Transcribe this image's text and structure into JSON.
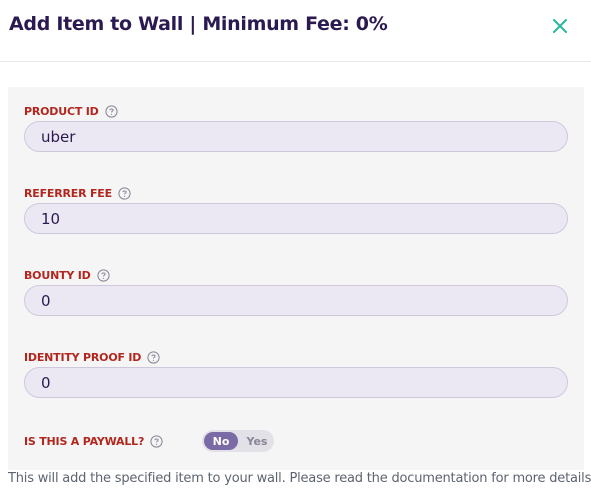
{
  "header": {
    "title": "Add Item to Wall | Minimum Fee: 0%",
    "close_icon": "close-icon"
  },
  "form": {
    "product_id": {
      "label": "PRODUCT ID",
      "value": "uber"
    },
    "referrer_fee": {
      "label": "REFERRER FEE",
      "value": "10"
    },
    "bounty_id": {
      "label": "BOUNTY ID",
      "value": "0"
    },
    "identity_proof_id": {
      "label": "IDENTITY PROOF ID",
      "value": "0"
    },
    "paywall": {
      "label": "IS THIS A PAYWALL?",
      "no_label": "No",
      "yes_label": "Yes",
      "selected": "No"
    }
  },
  "footer": {
    "note": "This will add the specified item to your wall. Please read the documentation for more details."
  },
  "colors": {
    "title": "#2b1a52",
    "label": "#b3261e",
    "close": "#2bb5a0",
    "input_bg": "#ece8f3",
    "toggle_active": "#7a6aa6"
  }
}
